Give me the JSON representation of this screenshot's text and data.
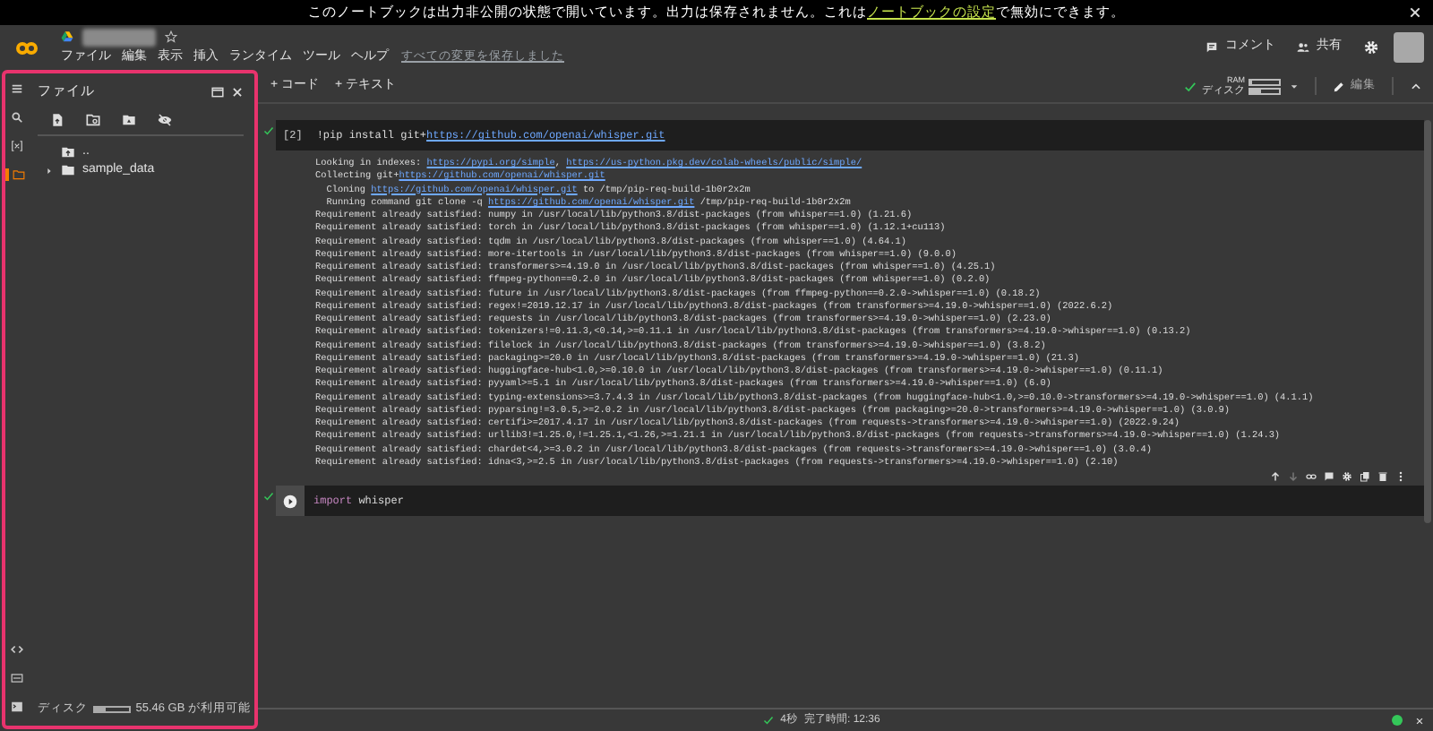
{
  "banner": {
    "before": "このノートブックは出力非公開の状態で開いています。出力は保存されません。これは",
    "link": "ノートブックの設定",
    "after": "で無効にできます。"
  },
  "header": {
    "menu": [
      "ファイル",
      "編集",
      "表示",
      "挿入",
      "ランタイム",
      "ツール",
      "ヘルプ"
    ],
    "save_status": "すべての変更を保存しました",
    "actions": [
      {
        "kind": "comment",
        "label": "コメント"
      },
      {
        "kind": "share",
        "label": "共有"
      }
    ]
  },
  "toolbar": {
    "buttons": [
      "+ コード",
      "+ テキスト"
    ],
    "connected": true,
    "resources": [
      {
        "label": "RAM",
        "level": 0.04
      },
      {
        "label": "ディスク",
        "level": 0.35
      }
    ],
    "edit_label": "編集"
  },
  "sidebar": {
    "rail": [
      {
        "kind": "search",
        "selected": false
      },
      {
        "kind": "variables",
        "selected": false
      },
      {
        "kind": "files",
        "selected": true
      }
    ],
    "title": "ファイル",
    "tree": [
      {
        "kind": "parent",
        "name": ".."
      },
      {
        "kind": "folder",
        "name": "sample_data",
        "expanded": false
      }
    ],
    "disk": {
      "label": "ディスク",
      "level": 0.3,
      "reading": "55.46 GB が利用可能"
    }
  },
  "cells": [
    {
      "count": "[2]",
      "executed": true,
      "code": [
        {
          "kind": "text",
          "text": "!pip install git+"
        },
        {
          "kind": "link",
          "text": "https://github.com/openai/whisper.git"
        }
      ],
      "output": [
        [
          {
            "kind": "text",
            "text": "Looking in indexes: "
          },
          {
            "kind": "link",
            "text": "https://pypi.org/simple"
          },
          {
            "kind": "text",
            "text": ", "
          },
          {
            "kind": "link",
            "text": "https://us-python.pkg.dev/colab-wheels/public/simple/"
          }
        ],
        [
          {
            "kind": "text",
            "text": "Collecting git+"
          },
          {
            "kind": "link",
            "text": "https://github.com/openai/whisper.git"
          }
        ],
        [
          {
            "kind": "text",
            "text": "  Cloning "
          },
          {
            "kind": "link",
            "text": "https://github.com/openai/whisper.git"
          },
          {
            "kind": "text",
            "text": " to /tmp/pip-req-build-1b0r2x2m"
          }
        ],
        [
          {
            "kind": "text",
            "text": "  Running command git clone -q "
          },
          {
            "kind": "link",
            "text": "https://github.com/openai/whisper.git"
          },
          {
            "kind": "text",
            "text": " /tmp/pip-req-build-1b0r2x2m"
          }
        ],
        [
          {
            "kind": "text",
            "text": "Requirement already satisfied: numpy in /usr/local/lib/python3.8/dist-packages (from whisper==1.0) (1.21.6)"
          }
        ],
        [
          {
            "kind": "text",
            "text": "Requirement already satisfied: torch in /usr/local/lib/python3.8/dist-packages (from whisper==1.0) (1.12.1+cu113)"
          }
        ],
        [
          {
            "kind": "text",
            "text": "Requirement already satisfied: tqdm in /usr/local/lib/python3.8/dist-packages (from whisper==1.0) (4.64.1)"
          }
        ],
        [
          {
            "kind": "text",
            "text": "Requirement already satisfied: more-itertools in /usr/local/lib/python3.8/dist-packages (from whisper==1.0) (9.0.0)"
          }
        ],
        [
          {
            "kind": "text",
            "text": "Requirement already satisfied: transformers>=4.19.0 in /usr/local/lib/python3.8/dist-packages (from whisper==1.0) (4.25.1)"
          }
        ],
        [
          {
            "kind": "text",
            "text": "Requirement already satisfied: ffmpeg-python==0.2.0 in /usr/local/lib/python3.8/dist-packages (from whisper==1.0) (0.2.0)"
          }
        ],
        [
          {
            "kind": "text",
            "text": "Requirement already satisfied: future in /usr/local/lib/python3.8/dist-packages (from ffmpeg-python==0.2.0->whisper==1.0) (0.18.2)"
          }
        ],
        [
          {
            "kind": "text",
            "text": "Requirement already satisfied: regex!=2019.12.17 in /usr/local/lib/python3.8/dist-packages (from transformers>=4.19.0->whisper==1.0) (2022.6.2)"
          }
        ],
        [
          {
            "kind": "text",
            "text": "Requirement already satisfied: requests in /usr/local/lib/python3.8/dist-packages (from transformers>=4.19.0->whisper==1.0) (2.23.0)"
          }
        ],
        [
          {
            "kind": "text",
            "text": "Requirement already satisfied: tokenizers!=0.11.3,<0.14,>=0.11.1 in /usr/local/lib/python3.8/dist-packages (from transformers>=4.19.0->whisper==1.0) (0.13.2)"
          }
        ],
        [
          {
            "kind": "text",
            "text": "Requirement already satisfied: filelock in /usr/local/lib/python3.8/dist-packages (from transformers>=4.19.0->whisper==1.0) (3.8.2)"
          }
        ],
        [
          {
            "kind": "text",
            "text": "Requirement already satisfied: packaging>=20.0 in /usr/local/lib/python3.8/dist-packages (from transformers>=4.19.0->whisper==1.0) (21.3)"
          }
        ],
        [
          {
            "kind": "text",
            "text": "Requirement already satisfied: huggingface-hub<1.0,>=0.10.0 in /usr/local/lib/python3.8/dist-packages (from transformers>=4.19.0->whisper==1.0) (0.11.1)"
          }
        ],
        [
          {
            "kind": "text",
            "text": "Requirement already satisfied: pyyaml>=5.1 in /usr/local/lib/python3.8/dist-packages (from transformers>=4.19.0->whisper==1.0) (6.0)"
          }
        ],
        [
          {
            "kind": "text",
            "text": "Requirement already satisfied: typing-extensions>=3.7.4.3 in /usr/local/lib/python3.8/dist-packages (from huggingface-hub<1.0,>=0.10.0->transformers>=4.19.0->whisper==1.0) (4.1.1)"
          }
        ],
        [
          {
            "kind": "text",
            "text": "Requirement already satisfied: pyparsing!=3.0.5,>=2.0.2 in /usr/local/lib/python3.8/dist-packages (from packaging>=20.0->transformers>=4.19.0->whisper==1.0) (3.0.9)"
          }
        ],
        [
          {
            "kind": "text",
            "text": "Requirement already satisfied: certifi>=2017.4.17 in /usr/local/lib/python3.8/dist-packages (from requests->transformers>=4.19.0->whisper==1.0) (2022.9.24)"
          }
        ],
        [
          {
            "kind": "text",
            "text": "Requirement already satisfied: urllib3!=1.25.0,!=1.25.1,<1.26,>=1.21.1 in /usr/local/lib/python3.8/dist-packages (from requests->transformers>=4.19.0->whisper==1.0) (1.24.3)"
          }
        ],
        [
          {
            "kind": "text",
            "text": "Requirement already satisfied: chardet<4,>=3.0.2 in /usr/local/lib/python3.8/dist-packages (from requests->transformers>=4.19.0->whisper==1.0) (3.0.4)"
          }
        ],
        [
          {
            "kind": "text",
            "text": "Requirement already satisfied: idna<3,>=2.5 in /usr/local/lib/python3.8/dist-packages (from requests->transformers>=4.19.0->whisper==1.0) (2.10)"
          }
        ]
      ]
    },
    {
      "executed": true,
      "code": [
        {
          "kind": "keyword",
          "text": "import"
        },
        {
          "kind": "text",
          "text": " whisper"
        }
      ]
    }
  ],
  "status": {
    "done": true,
    "duration": "4秒",
    "finished": "完了時間: 12:36",
    "connected": true
  }
}
